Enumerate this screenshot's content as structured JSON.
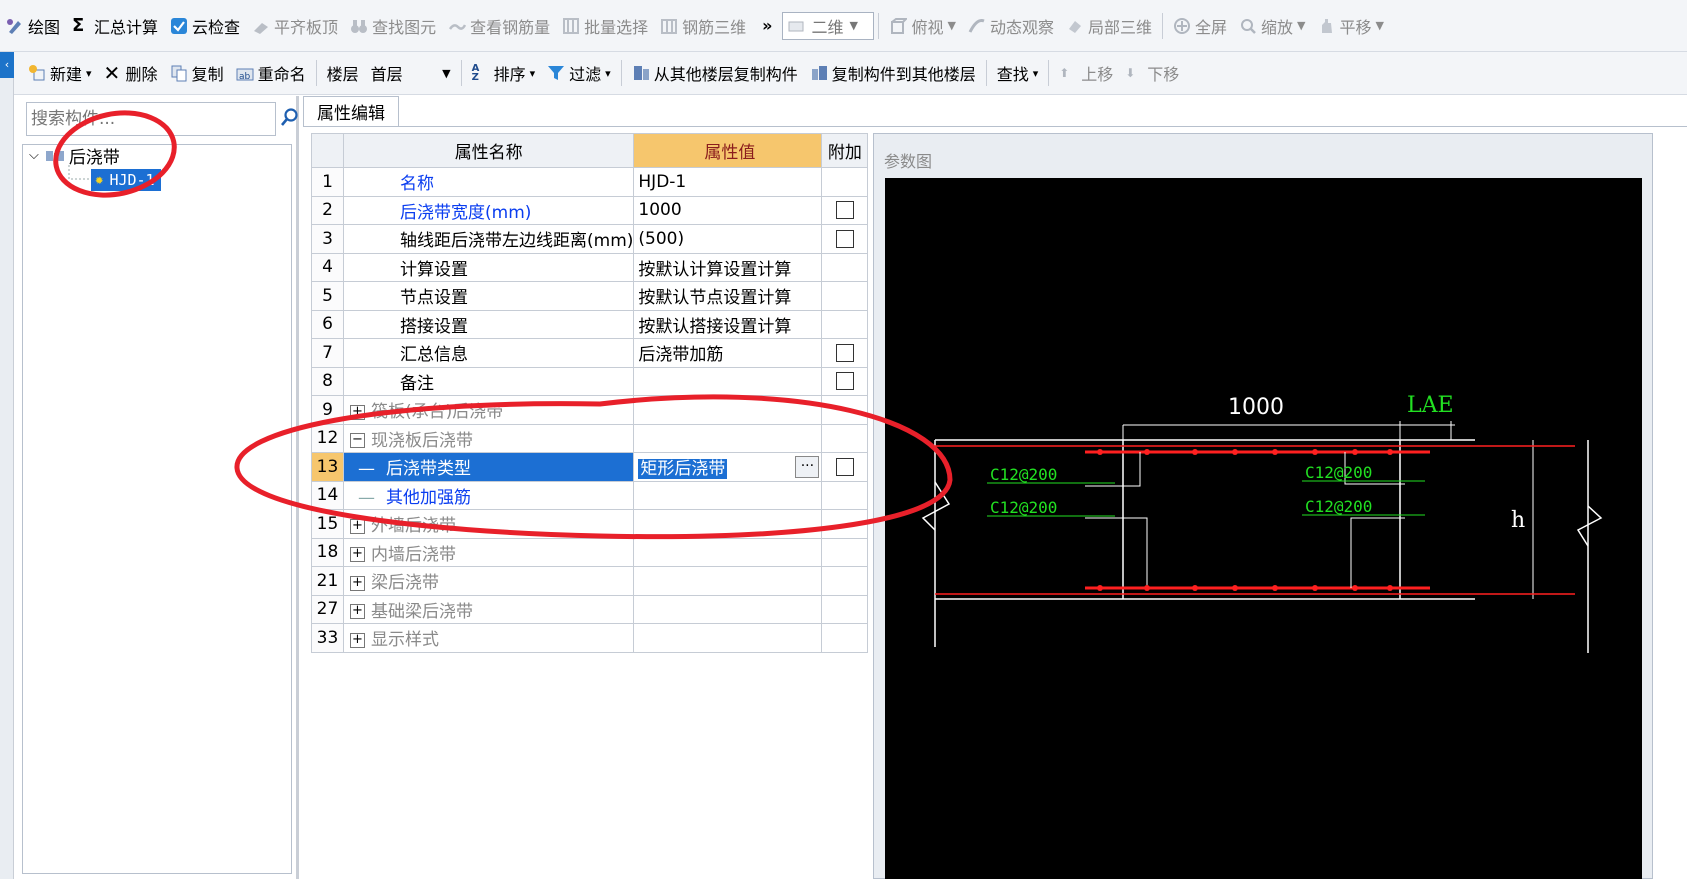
{
  "toolbar_main": [
    {
      "name": "draw-button",
      "icon": "draw-icon",
      "label": "绘图",
      "enabled": true
    },
    {
      "name": "summary-calc-button",
      "icon": "sigma-icon",
      "label": "汇总计算",
      "enabled": true
    },
    {
      "name": "cloud-check-button",
      "icon": "cloud-check-icon",
      "label": "云检查",
      "enabled": true
    },
    {
      "name": "align-slab-top-button",
      "icon": "align-icon",
      "label": "平齐板顶",
      "enabled": false
    },
    {
      "name": "find-element-button",
      "icon": "binoculars-icon",
      "label": "查找图元",
      "enabled": false
    },
    {
      "name": "view-rebar-qty-button",
      "icon": "link-icon",
      "label": "查看钢筋量",
      "enabled": false
    },
    {
      "name": "batch-select-button",
      "icon": "batch-icon",
      "label": "批量选择",
      "enabled": false
    },
    {
      "name": "rebar-3d-button",
      "icon": "rebar-3d-icon",
      "label": "钢筋三维",
      "enabled": false
    }
  ],
  "view_mode": "二维",
  "toolbar_view": [
    {
      "name": "top-view-button",
      "icon": "cube-icon",
      "label": "俯视"
    },
    {
      "name": "dynamic-view-button",
      "icon": "orbit-icon",
      "label": "动态观察"
    },
    {
      "name": "local-3d-button",
      "icon": "local-3d-icon",
      "label": "局部三维"
    },
    {
      "name": "fullscreen-button",
      "icon": "fullscreen-icon",
      "label": "全屏"
    },
    {
      "name": "zoom-button",
      "icon": "zoom-icon",
      "label": "缩放"
    },
    {
      "name": "pan-button",
      "icon": "pan-icon",
      "label": "平移"
    }
  ],
  "toolbar_second": {
    "new_label": "新建",
    "delete_label": "删除",
    "copy_label": "复制",
    "rename_label": "重命名",
    "floor_label": "楼层",
    "floor_value": "首层",
    "sort_label": "排序",
    "filter_label": "过滤",
    "copy_from_label": "从其他楼层复制构件",
    "copy_to_label": "复制构件到其他楼层",
    "find_label": "查找",
    "move_up_label": "上移",
    "move_down_label": "下移"
  },
  "tree": {
    "search_placeholder": "搜索构件...",
    "root_label": "后浇带",
    "child_label": "HJD-1"
  },
  "property_tab_label": "属性编辑",
  "props": {
    "headers": {
      "name": "属性名称",
      "value": "属性值",
      "extra": "附加"
    },
    "rows": [
      {
        "num": "1",
        "name": "名称",
        "value": "HJD-1",
        "style": "blue",
        "check": false,
        "kind": "plain"
      },
      {
        "num": "2",
        "name": "后浇带宽度(mm)",
        "value": "1000",
        "style": "blue",
        "check": true,
        "kind": "plain"
      },
      {
        "num": "3",
        "name": "轴线距后浇带左边线距离(mm)",
        "value": "(500)",
        "style": "black",
        "check": true,
        "kind": "plain"
      },
      {
        "num": "4",
        "name": "计算设置",
        "value": "按默认计算设置计算",
        "style": "black",
        "check": false,
        "kind": "plain"
      },
      {
        "num": "5",
        "name": "节点设置",
        "value": "按默认节点设置计算",
        "style": "black",
        "check": false,
        "kind": "plain"
      },
      {
        "num": "6",
        "name": "搭接设置",
        "value": "按默认搭接设置计算",
        "style": "black",
        "check": false,
        "kind": "plain"
      },
      {
        "num": "7",
        "name": "汇总信息",
        "value": "后浇带加筋",
        "style": "black",
        "check": true,
        "kind": "plain"
      },
      {
        "num": "8",
        "name": "备注",
        "value": "",
        "style": "black",
        "check": true,
        "kind": "plain"
      },
      {
        "num": "9",
        "name": "筏板(承台)后浇带",
        "value": "",
        "style": "grey",
        "check": false,
        "kind": "collapsed"
      },
      {
        "num": "12",
        "name": "现浇板后浇带",
        "value": "",
        "style": "grey",
        "check": false,
        "kind": "expanded"
      },
      {
        "num": "13",
        "name": "后浇带类型",
        "value": "矩形后浇带",
        "style": "selected",
        "check": true,
        "kind": "child"
      },
      {
        "num": "14",
        "name": "其他加强筋",
        "value": "",
        "style": "blue",
        "check": false,
        "kind": "child"
      },
      {
        "num": "15",
        "name": "外墙后浇带",
        "value": "",
        "style": "grey",
        "check": false,
        "kind": "collapsed"
      },
      {
        "num": "18",
        "name": "内墙后浇带",
        "value": "",
        "style": "grey",
        "check": false,
        "kind": "collapsed"
      },
      {
        "num": "21",
        "name": "梁后浇带",
        "value": "",
        "style": "grey",
        "check": false,
        "kind": "collapsed"
      },
      {
        "num": "27",
        "name": "基础梁后浇带",
        "value": "",
        "style": "grey",
        "check": false,
        "kind": "collapsed"
      },
      {
        "num": "33",
        "name": "显示样式",
        "value": "",
        "style": "grey",
        "check": false,
        "kind": "collapsed"
      }
    ]
  },
  "diagram": {
    "title": "参数图",
    "width_label": "1000",
    "lae_label": "LAE",
    "rebar_labels": [
      "C12@200",
      "C12@200",
      "C12@200",
      "C12@200"
    ],
    "height_label": "h"
  },
  "colors": {
    "accent_blue": "#1c6fd3",
    "header_orange": "#f6c66d",
    "annotation_red": "#e8202a",
    "rebar_red": "#ff2020",
    "label_green": "#22e022"
  }
}
